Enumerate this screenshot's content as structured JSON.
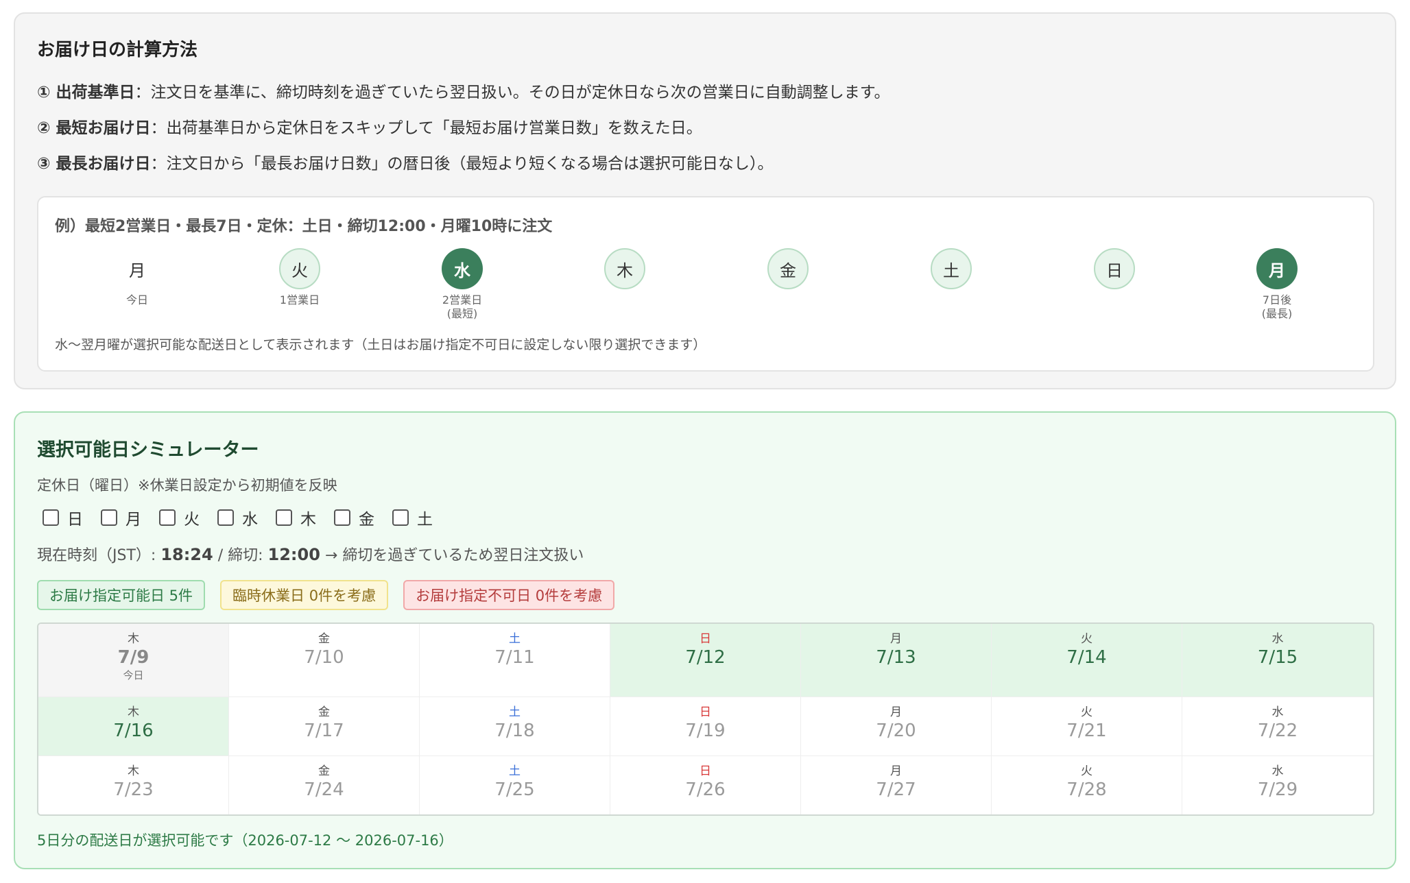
{
  "explain": {
    "title": "お届け日の計算方法",
    "rules": [
      {
        "label": "① 出荷基準日",
        "text": "：注文日を基準に、締切時刻を過ぎていたら翌日扱い。その日が定休日なら次の営業日に自動調整します。"
      },
      {
        "label": "② 最短お届け日",
        "text": "：出荷基準日から定休日をスキップして「最短お届け営業日数」を数えた日。"
      },
      {
        "label": "③ 最長お届け日",
        "text": "：注文日から「最長お届け日数」の暦日後（最短より短くなる場合は選択可能日なし）。"
      }
    ],
    "example": {
      "title": "例）最短2営業日・最長7日・定休：土日・締切12:00・月曜10時に注文",
      "days": [
        {
          "label": "月",
          "style": "plain",
          "sub1": "今日",
          "sub2": ""
        },
        {
          "label": "火",
          "style": "light",
          "sub1": "1営業日",
          "sub2": ""
        },
        {
          "label": "水",
          "style": "dark",
          "sub1": "2営業日",
          "sub2": "(最短)"
        },
        {
          "label": "木",
          "style": "light",
          "sub1": "",
          "sub2": ""
        },
        {
          "label": "金",
          "style": "light",
          "sub1": "",
          "sub2": ""
        },
        {
          "label": "土",
          "style": "light",
          "sub1": "",
          "sub2": ""
        },
        {
          "label": "日",
          "style": "light",
          "sub1": "",
          "sub2": ""
        },
        {
          "label": "月",
          "style": "dark",
          "sub1": "7日後",
          "sub2": "(最長)"
        }
      ],
      "note": "水〜翌月曜が選択可能な配送日として表示されます（土日はお届け指定不可日に設定しない限り選択できます）"
    }
  },
  "simulator": {
    "title": "選択可能日シミュレーター",
    "holiday_label": "定休日（曜日）※休業日設定から初期値を反映",
    "weekdays": [
      {
        "label": "日",
        "checked": false
      },
      {
        "label": "月",
        "checked": false
      },
      {
        "label": "火",
        "checked": false
      },
      {
        "label": "水",
        "checked": false
      },
      {
        "label": "木",
        "checked": false
      },
      {
        "label": "金",
        "checked": false
      },
      {
        "label": "土",
        "checked": false
      }
    ],
    "time": {
      "prefix": "現在時刻（JST）: ",
      "current": "18:24",
      "mid": " / 締切: ",
      "cutoff": "12:00",
      "suffix": " → 締切を過ぎているため翌日注文扱い"
    },
    "badges": {
      "available": "お届け指定可能日 5件",
      "temp_holiday": "臨時休業日 0件を考慮",
      "unavailable": "お届け指定不可日 0件を考慮"
    },
    "calendar": [
      [
        {
          "wd": "木",
          "date": "7/9",
          "sub": "今日",
          "state": "today",
          "kind": ""
        },
        {
          "wd": "金",
          "date": "7/10",
          "sub": "",
          "state": "",
          "kind": ""
        },
        {
          "wd": "土",
          "date": "7/11",
          "sub": "",
          "state": "",
          "kind": "sat"
        },
        {
          "wd": "日",
          "date": "7/12",
          "sub": "",
          "state": "selectable",
          "kind": "sun"
        },
        {
          "wd": "月",
          "date": "7/13",
          "sub": "",
          "state": "selectable",
          "kind": ""
        },
        {
          "wd": "火",
          "date": "7/14",
          "sub": "",
          "state": "selectable",
          "kind": ""
        },
        {
          "wd": "水",
          "date": "7/15",
          "sub": "",
          "state": "selectable",
          "kind": ""
        }
      ],
      [
        {
          "wd": "木",
          "date": "7/16",
          "sub": "",
          "state": "selectable",
          "kind": ""
        },
        {
          "wd": "金",
          "date": "7/17",
          "sub": "",
          "state": "",
          "kind": ""
        },
        {
          "wd": "土",
          "date": "7/18",
          "sub": "",
          "state": "",
          "kind": "sat"
        },
        {
          "wd": "日",
          "date": "7/19",
          "sub": "",
          "state": "",
          "kind": "sun"
        },
        {
          "wd": "月",
          "date": "7/20",
          "sub": "",
          "state": "",
          "kind": ""
        },
        {
          "wd": "火",
          "date": "7/21",
          "sub": "",
          "state": "",
          "kind": ""
        },
        {
          "wd": "水",
          "date": "7/22",
          "sub": "",
          "state": "",
          "kind": ""
        }
      ],
      [
        {
          "wd": "木",
          "date": "7/23",
          "sub": "",
          "state": "",
          "kind": ""
        },
        {
          "wd": "金",
          "date": "7/24",
          "sub": "",
          "state": "",
          "kind": ""
        },
        {
          "wd": "土",
          "date": "7/25",
          "sub": "",
          "state": "",
          "kind": "sat"
        },
        {
          "wd": "日",
          "date": "7/26",
          "sub": "",
          "state": "",
          "kind": "sun"
        },
        {
          "wd": "月",
          "date": "7/27",
          "sub": "",
          "state": "",
          "kind": ""
        },
        {
          "wd": "火",
          "date": "7/28",
          "sub": "",
          "state": "",
          "kind": ""
        },
        {
          "wd": "水",
          "date": "7/29",
          "sub": "",
          "state": "",
          "kind": ""
        }
      ]
    ],
    "footer": "5日分の配送日が選択可能です（2026-07-12 〜 2026-07-16）"
  }
}
